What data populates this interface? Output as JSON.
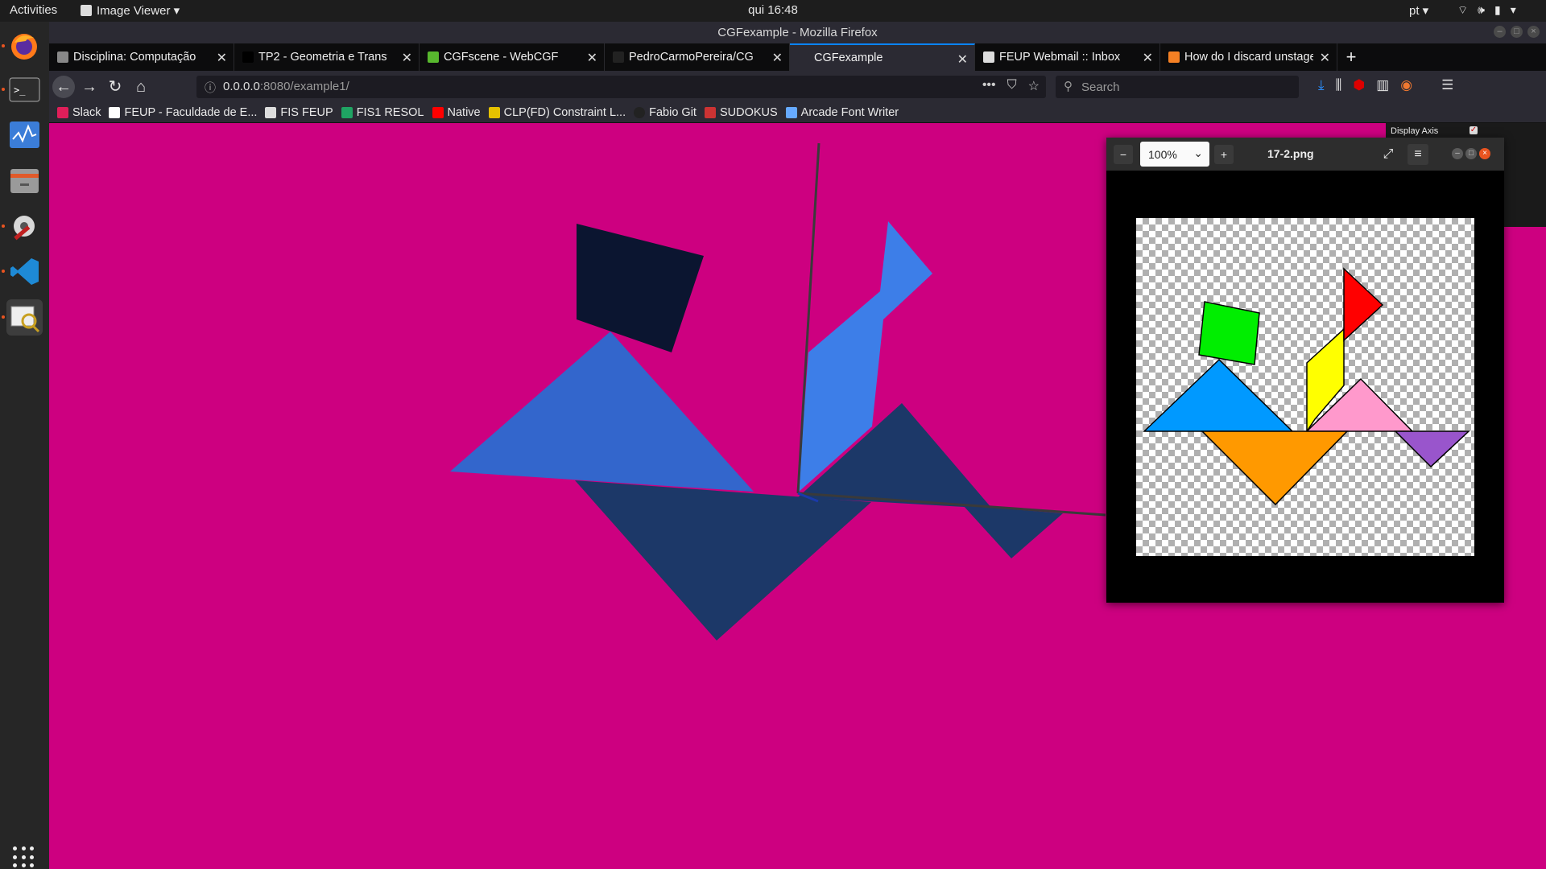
{
  "topbar": {
    "activities": "Activities",
    "app_menu": "Image Viewer ▾",
    "clock": "qui 16:48",
    "language": "pt ▾"
  },
  "window": {
    "title": "CGFexample - Mozilla Firefox"
  },
  "tabs": [
    {
      "label": "Disciplina: Computação",
      "favicon_color": "#888888"
    },
    {
      "label": "TP2 - Geometria e Transform",
      "favicon_color": "#000000"
    },
    {
      "label": "CGFscene - WebCGF",
      "favicon_color": "#58b82e"
    },
    {
      "label": "PedroCarmoPereira/CG",
      "favicon_color": "#222222"
    },
    {
      "label": "CGFexample",
      "favicon_color": "#2b2a33"
    },
    {
      "label": "FEUP Webmail :: Inbox",
      "favicon_color": "#dddddd"
    },
    {
      "label": "How do I discard unstage",
      "favicon_color": "#f48024"
    }
  ],
  "active_tab_index": 4,
  "url": {
    "host": "0.0.0.0",
    "rest": ":8080/example1/"
  },
  "search": {
    "placeholder": "Search"
  },
  "bookmarks": [
    {
      "label": "Slack",
      "favicon_color": "#e01e5a"
    },
    {
      "label": "FEUP - Faculdade de E...",
      "favicon_color": "#ffffff"
    },
    {
      "label": "FIS FEUP",
      "favicon_color": "#dddddd"
    },
    {
      "label": "FIS1 RESOL",
      "favicon_color": "#1fa463"
    },
    {
      "label": "Native",
      "favicon_color": "#ff0000"
    },
    {
      "label": "CLP(FD) Constraint L...",
      "favicon_color": "#e6c200"
    },
    {
      "label": "Fabio Git",
      "favicon_color": "#222222"
    },
    {
      "label": "SUDOKUS",
      "favicon_color": "#cc3333"
    },
    {
      "label": "Arcade Font Writer",
      "favicon_color": "#66aaff"
    }
  ],
  "gui_panel": {
    "display_axis_label": "Display Axis",
    "display_axis_checked": true
  },
  "image_viewer": {
    "zoom_value": "100%",
    "filename": "17-2.png"
  },
  "scene_colors": {
    "background": "#cd0080",
    "square": "#0b1530",
    "big_triangle_left": "#3366cc",
    "big_triangle_bottom": "#1c3868",
    "parallelogram": "#3d7ee8"
  },
  "tangram_reference_colors": {
    "square": "#00ee00",
    "triangle_left": "#0099ff",
    "parallelogram": "#ffff00",
    "triangle_top": "#ff0000",
    "triangle_pink": "#ff99cc",
    "triangle_bottom": "#ff9900",
    "triangle_right": "#9955cc"
  }
}
